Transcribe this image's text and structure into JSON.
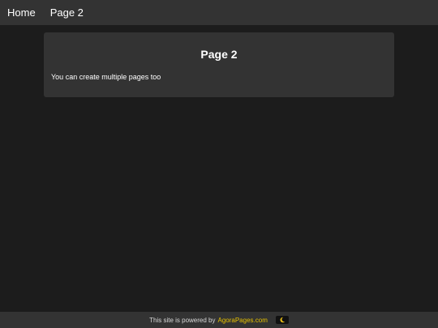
{
  "nav": {
    "items": [
      {
        "label": "Home"
      },
      {
        "label": "Page 2"
      }
    ]
  },
  "content": {
    "title": "Page 2",
    "body": "You can create multiple pages too"
  },
  "footer": {
    "text": "This site is powered by",
    "link_label": "AgoraPages.com",
    "toggle_icon": "moon-icon"
  },
  "colors": {
    "background": "#1c1c1c",
    "panel": "#333333",
    "link_accent": "#e8c200",
    "moon": "#f0c419"
  }
}
